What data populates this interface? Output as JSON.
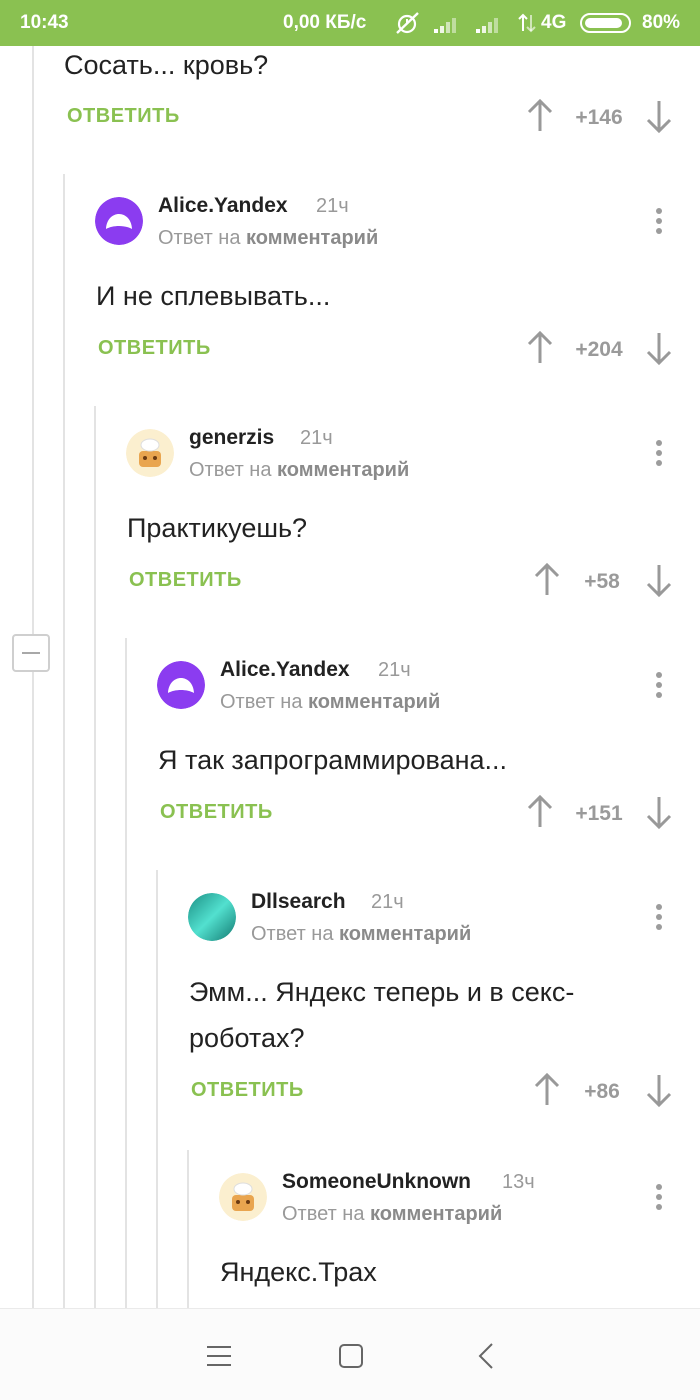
{
  "status_bar": {
    "time": "10:43",
    "speed": "0,00 КБ/с",
    "network": "4G",
    "battery": "80%",
    "icons": [
      "alarm-off-icon",
      "signal-icon",
      "signal-icon",
      "data-arrows-icon",
      "battery-icon"
    ]
  },
  "colors": {
    "accent": "#8ac151",
    "muted": "#999999",
    "text": "#222222"
  },
  "labels": {
    "reply_to_prefix": "Ответ на",
    "reply_to_target": "комментарий",
    "reply_button": "ОТВЕТИТЬ"
  },
  "top_comment": {
    "text": "Сосать... кровь?",
    "reply": "ОТВЕТИТЬ",
    "rating": "+146"
  },
  "comments": [
    {
      "author": "Alice.Yandex",
      "time": "21ч",
      "reply_prefix": "Ответ на",
      "reply_target": "комментарий",
      "text": "И не сплевывать...",
      "reply": "ОТВЕТИТЬ",
      "rating": "+204",
      "avatar": "alice-logo"
    },
    {
      "author": "generzis",
      "time": "21ч",
      "reply_prefix": "Ответ на",
      "reply_target": "комментарий",
      "text": "Практикуешь?",
      "reply": "ОТВЕТИТЬ",
      "rating": "+58",
      "avatar": "chef-avatar"
    },
    {
      "author": "Alice.Yandex",
      "time": "21ч",
      "reply_prefix": "Ответ на",
      "reply_target": "комментарий",
      "text": "Я так запрограммирована...",
      "reply": "ОТВЕТИТЬ",
      "rating": "+151",
      "avatar": "alice-logo"
    },
    {
      "author": "Dllsearch",
      "time": "21ч",
      "reply_prefix": "Ответ на",
      "reply_target": "комментарий",
      "text": "Эмм... Яндекс теперь и в секс-роботах?",
      "reply": "ОТВЕТИТЬ",
      "rating": "+86",
      "avatar": "teal-avatar"
    },
    {
      "author": "SomeoneUnknown",
      "time": "13ч",
      "reply_prefix": "Ответ на",
      "reply_target": "комментарий",
      "text": "Яндекс.Трах",
      "avatar": "chef-avatar"
    }
  ],
  "nav_bar": {
    "icons": [
      "menu-icon",
      "home-square-icon",
      "back-icon"
    ]
  }
}
